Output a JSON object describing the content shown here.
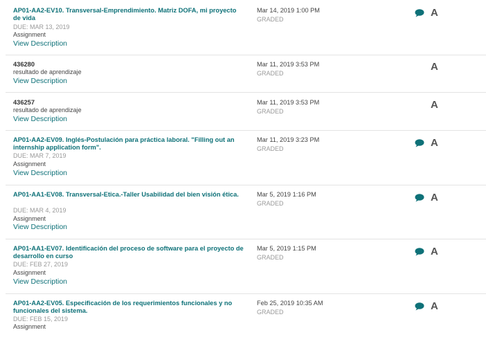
{
  "colors": {
    "accent": "#0e7178",
    "muted": "#999999",
    "grade": "#555555"
  },
  "rows": [
    {
      "title": "AP01-AA2-EV10. Transversal-Emprendimiento. Matriz DOFA, mi proyecto de vida",
      "due": "DUE: MAR 13, 2019",
      "kind": "Assignment",
      "link": "View Description",
      "date": "Mar 14, 2019 1:00 PM",
      "status": "GRADED",
      "grade": "A",
      "comment_icon": "comment-icon"
    },
    {
      "title": "436280",
      "kind": "resultado de aprendizaje",
      "link": "View Description",
      "date": "Mar 11, 2019 3:53 PM",
      "status": "GRADED",
      "grade": "A"
    },
    {
      "title": "436257",
      "kind": "resultado de aprendizaje",
      "link": "View Description",
      "date": "Mar 11, 2019 3:53 PM",
      "status": "GRADED",
      "grade": "A"
    },
    {
      "title": "AP01-AA2-EV09. Inglés-Postulación para práctica laboral. \"Filling out an internship application form\".",
      "due": "DUE: MAR 7, 2019",
      "kind": "Assignment",
      "link": "View Description",
      "date": "Mar 11, 2019 3:23 PM",
      "status": "GRADED",
      "grade": "A",
      "comment_icon": "comment-icon"
    },
    {
      "title": "AP01-AA1-EV08. Transversal-Etica.-Taller Usabilidad del bien visión ética.",
      "due": "DUE: MAR 4, 2019",
      "kind": "Assignment",
      "link": "View Description",
      "date": "Mar 5, 2019 1:16 PM",
      "status": "GRADED",
      "grade": "A",
      "comment_icon": "comment-icon"
    },
    {
      "title": "AP01-AA1-EV07. Identificación del proceso de software para el proyecto de desarrollo en curso",
      "due": "DUE: FEB 27, 2019",
      "kind": "Assignment",
      "link": "View Description",
      "date": "Mar 5, 2019 1:15 PM",
      "status": "GRADED",
      "grade": "A",
      "comment_icon": "comment-icon"
    },
    {
      "title": "AP01-AA2-EV05. Especificación de los requerimientos funcionales y no funcionales del sistema.",
      "due": "DUE: FEB 15, 2019",
      "kind": "Assignment",
      "date": "Feb 25, 2019 10:35 AM",
      "status": "GRADED",
      "grade": "A",
      "comment_icon": "comment-icon"
    }
  ]
}
